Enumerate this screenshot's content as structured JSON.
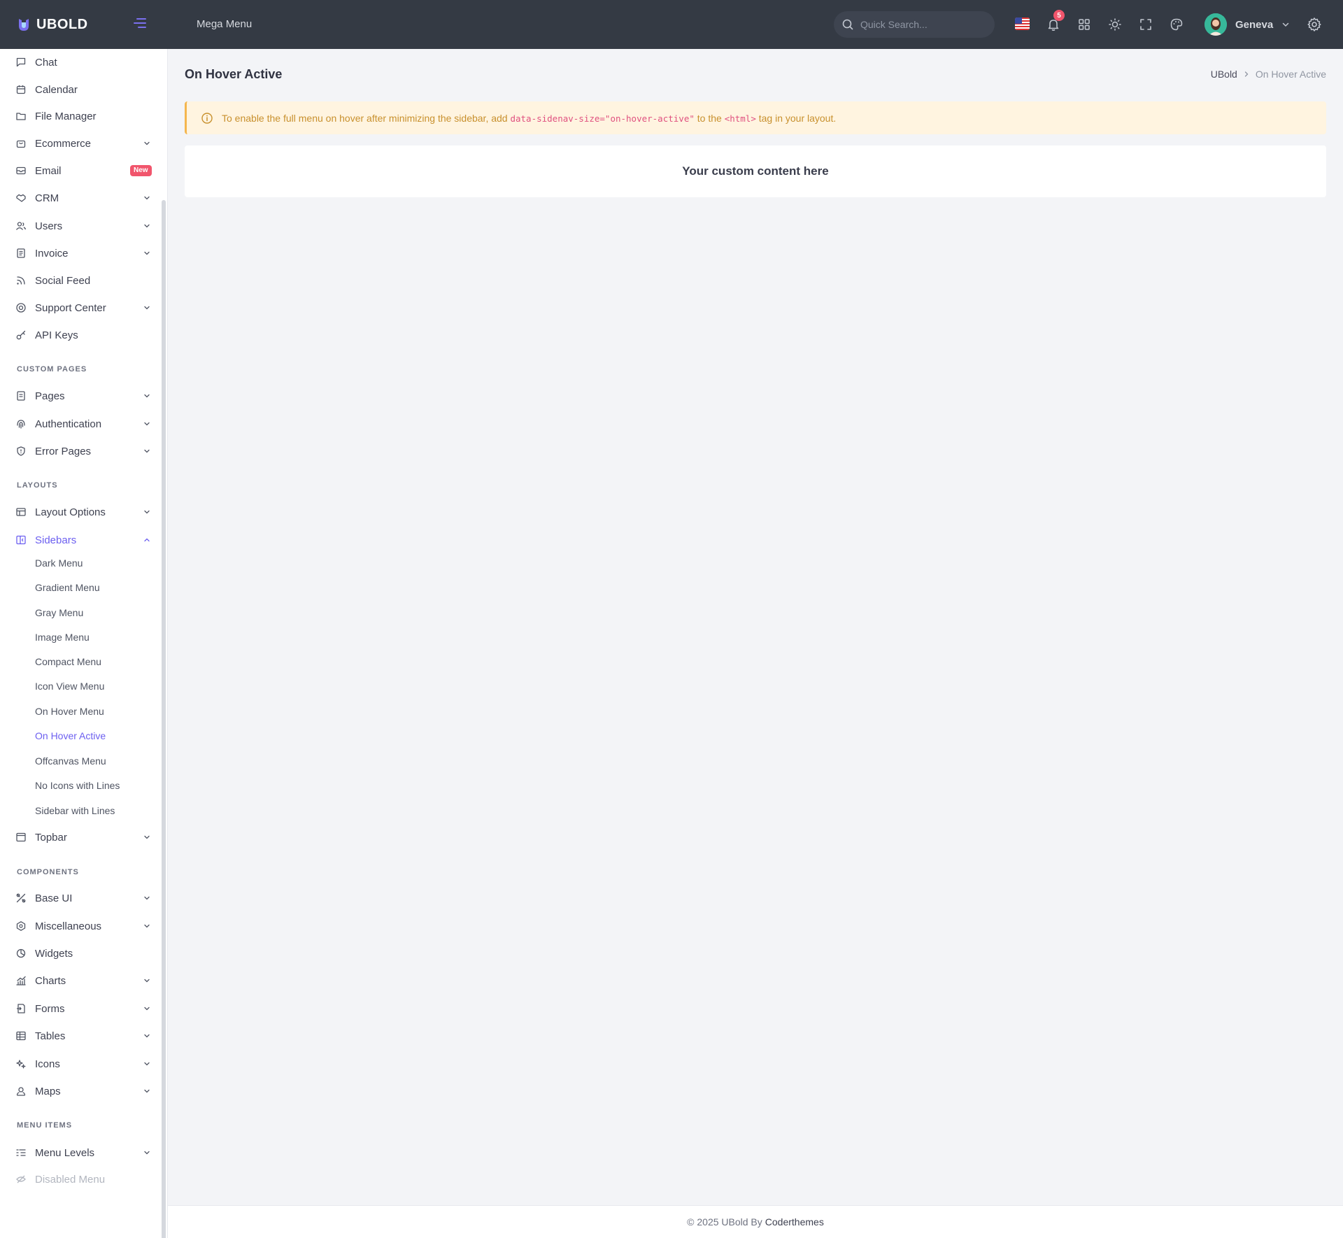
{
  "topbar": {
    "logo_text": "UBOLD",
    "mega_menu": "Mega Menu",
    "search_placeholder": "Quick Search...",
    "notification_count": "5",
    "user_name": "Geneva"
  },
  "sidebar": {
    "items_top": [
      {
        "label": "Chat",
        "icon": "chat-icon"
      },
      {
        "label": "Calendar",
        "icon": "calendar-icon"
      },
      {
        "label": "File Manager",
        "icon": "folder-icon"
      },
      {
        "label": "Ecommerce",
        "icon": "bag-icon"
      },
      {
        "label": "Email",
        "icon": "mail-icon",
        "badge": "New"
      },
      {
        "label": "CRM",
        "icon": "handshake-icon"
      },
      {
        "label": "Users",
        "icon": "users-icon"
      },
      {
        "label": "Invoice",
        "icon": "invoice-icon"
      },
      {
        "label": "Social Feed",
        "icon": "rss-icon"
      },
      {
        "label": "Support Center",
        "icon": "lifebuoy-icon"
      },
      {
        "label": "API Keys",
        "icon": "key-icon"
      }
    ],
    "section_custom_pages": "CUSTOM PAGES",
    "items_custom": [
      {
        "label": "Pages",
        "icon": "page-icon"
      },
      {
        "label": "Authentication",
        "icon": "fingerprint-icon"
      },
      {
        "label": "Error Pages",
        "icon": "shield-icon"
      }
    ],
    "section_layouts": "LAYOUTS",
    "layout_options": "Layout Options",
    "sidebars": "Sidebars",
    "sidebar_sub": [
      "Dark Menu",
      "Gradient Menu",
      "Gray Menu",
      "Image Menu",
      "Compact Menu",
      "Icon View Menu",
      "On Hover Menu",
      "On Hover Active",
      "Offcanvas Menu",
      "No Icons with Lines",
      "Sidebar with Lines"
    ],
    "topbar_item": "Topbar",
    "section_components": "COMPONENTS",
    "items_components": [
      {
        "label": "Base UI",
        "icon": "tools-icon"
      },
      {
        "label": "Miscellaneous",
        "icon": "hexagon-icon"
      },
      {
        "label": "Widgets",
        "icon": "widget-icon"
      },
      {
        "label": "Charts",
        "icon": "chart-icon"
      },
      {
        "label": "Forms",
        "icon": "form-icon"
      },
      {
        "label": "Tables",
        "icon": "table-icon"
      },
      {
        "label": "Icons",
        "icon": "sparkle-icon"
      },
      {
        "label": "Maps",
        "icon": "map-pin-icon"
      }
    ],
    "section_menu_items": "MENU ITEMS",
    "menu_levels": "Menu Levels",
    "disabled_menu": "Disabled Menu"
  },
  "main": {
    "page_title": "On Hover Active",
    "breadcrumb_root": "UBold",
    "breadcrumb_current": "On Hover Active",
    "alert_prefix": "To enable the full menu on hover after minimizing the sidebar, add",
    "alert_code1": "data-sidenav-size=\"on-hover-active\"",
    "alert_mid": "to the",
    "alert_code2": "<html>",
    "alert_suffix": "tag in your layout.",
    "card_text": "Your custom content here"
  },
  "footer": {
    "text": "© 2025 UBold By",
    "brand": "Coderthemes"
  },
  "colors": {
    "topbar_bg": "#343a44",
    "accent": "#6c5ff0",
    "badge": "#f1556c",
    "alert_bg": "#fff4e0",
    "alert_text": "#c8902d"
  }
}
